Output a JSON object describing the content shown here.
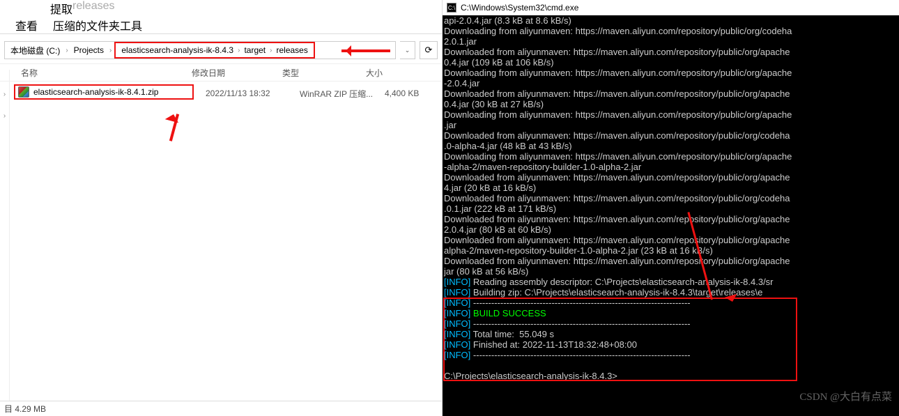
{
  "ribbon": {
    "tab_extract": "提取",
    "tab_releases": "releases",
    "view": "查看",
    "compress_tools": "压缩的文件夹工具"
  },
  "breadcrumb": {
    "segs": [
      "本地磁盘 (C:)",
      "Projects",
      "elasticsearch-analysis-ik-8.4.3",
      "target",
      "releases"
    ]
  },
  "columns": {
    "name": "名称",
    "date": "修改日期",
    "type": "类型",
    "size": "大小"
  },
  "file": {
    "name": "elasticsearch-analysis-ik-8.4.1.zip",
    "date": "2022/11/13 18:32",
    "type": "WinRAR ZIP 压缩...",
    "size": "4,400 KB"
  },
  "status": {
    "text": "目  4.29 MB"
  },
  "cmd": {
    "title": "C:\\Windows\\System32\\cmd.exe",
    "lines": [
      "api-2.0.4.jar (8.3 kB at 8.6 kB/s)",
      "Downloading from aliyunmaven: https://maven.aliyun.com/repository/public/org/codeha",
      "2.0.1.jar",
      "Downloaded from aliyunmaven: https://maven.aliyun.com/repository/public/org/apache",
      "0.4.jar (109 kB at 106 kB/s)",
      "Downloading from aliyunmaven: https://maven.aliyun.com/repository/public/org/apache",
      "-2.0.4.jar",
      "Downloaded from aliyunmaven: https://maven.aliyun.com/repository/public/org/apache",
      "0.4.jar (30 kB at 27 kB/s)",
      "Downloading from aliyunmaven: https://maven.aliyun.com/repository/public/org/apache",
      ".jar",
      "Downloaded from aliyunmaven: https://maven.aliyun.com/repository/public/org/codeha",
      ".0-alpha-4.jar (48 kB at 43 kB/s)",
      "Downloading from aliyunmaven: https://maven.aliyun.com/repository/public/org/apache",
      "-alpha-2/maven-repository-builder-1.0-alpha-2.jar",
      "Downloaded from aliyunmaven: https://maven.aliyun.com/repository/public/org/apache",
      "4.jar (20 kB at 16 kB/s)",
      "Downloaded from aliyunmaven: https://maven.aliyun.com/repository/public/org/codeha",
      ".0.1.jar (222 kB at 171 kB/s)",
      "Downloaded from aliyunmaven: https://maven.aliyun.com/repository/public/org/apache",
      "2.0.4.jar (80 kB at 60 kB/s)",
      "Downloaded from aliyunmaven: https://maven.aliyun.com/repository/public/org/apache",
      "alpha-2/maven-repository-builder-1.0-alpha-2.jar (23 kB at 16 kB/s)",
      "Downloaded from aliyunmaven: https://maven.aliyun.com/repository/public/org/apache",
      "jar (80 kB at 56 kB/s)"
    ],
    "info_lines": [
      {
        "pre": "[INFO] ",
        "text": "Reading assembly descriptor: C:\\Projects\\elasticsearch-analysis-ik-8.4.3/sr"
      },
      {
        "pre": "[INFO] ",
        "text": "Building zip: C:\\Projects\\elasticsearch-analysis-ik-8.4.3\\target\\releases\\e"
      },
      {
        "pre": "[INFO] ",
        "text": "------------------------------------------------------------------------"
      },
      {
        "pre": "[INFO] ",
        "text": "BUILD SUCCESS",
        "success": true
      },
      {
        "pre": "[INFO] ",
        "text": "------------------------------------------------------------------------"
      },
      {
        "pre": "[INFO] ",
        "text": "Total time:  55.049 s"
      },
      {
        "pre": "[INFO] ",
        "text": "Finished at: 2022-11-13T18:32:48+08:00"
      },
      {
        "pre": "[INFO] ",
        "text": "------------------------------------------------------------------------"
      }
    ],
    "prompt": "C:\\Projects\\elasticsearch-analysis-ik-8.4.3>"
  },
  "watermark": "CSDN @大白有点菜"
}
